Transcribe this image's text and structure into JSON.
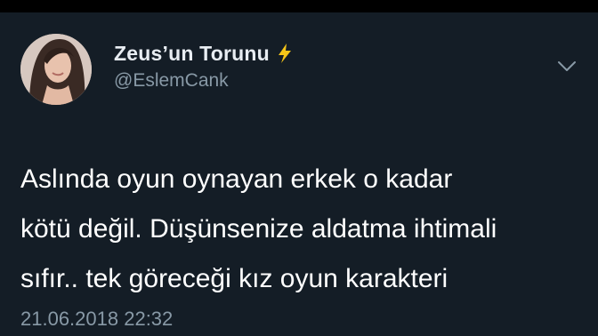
{
  "tweet": {
    "author": {
      "display_name": "Zeus’un Torunu",
      "handle": "@EslemCank",
      "verified_badge_icon": "lightning-bolt-icon",
      "avatar": "profile-photo"
    },
    "menu_icon": "chevron-down-icon",
    "text_lines": [
      "Aslında oyun oynayan erkek o kadar",
      "kötü değil. Düşünsenize aldatma ihtimali",
      "sıfır.. tek göreceği kız oyun karakteri"
    ],
    "timestamp": "21.06.2018 22:32"
  },
  "colors": {
    "background": "#141d26",
    "name_text": "#e8edf2",
    "body_text": "#ffffff",
    "secondary_text": "#8899a6",
    "bolt": "#f5c518"
  }
}
